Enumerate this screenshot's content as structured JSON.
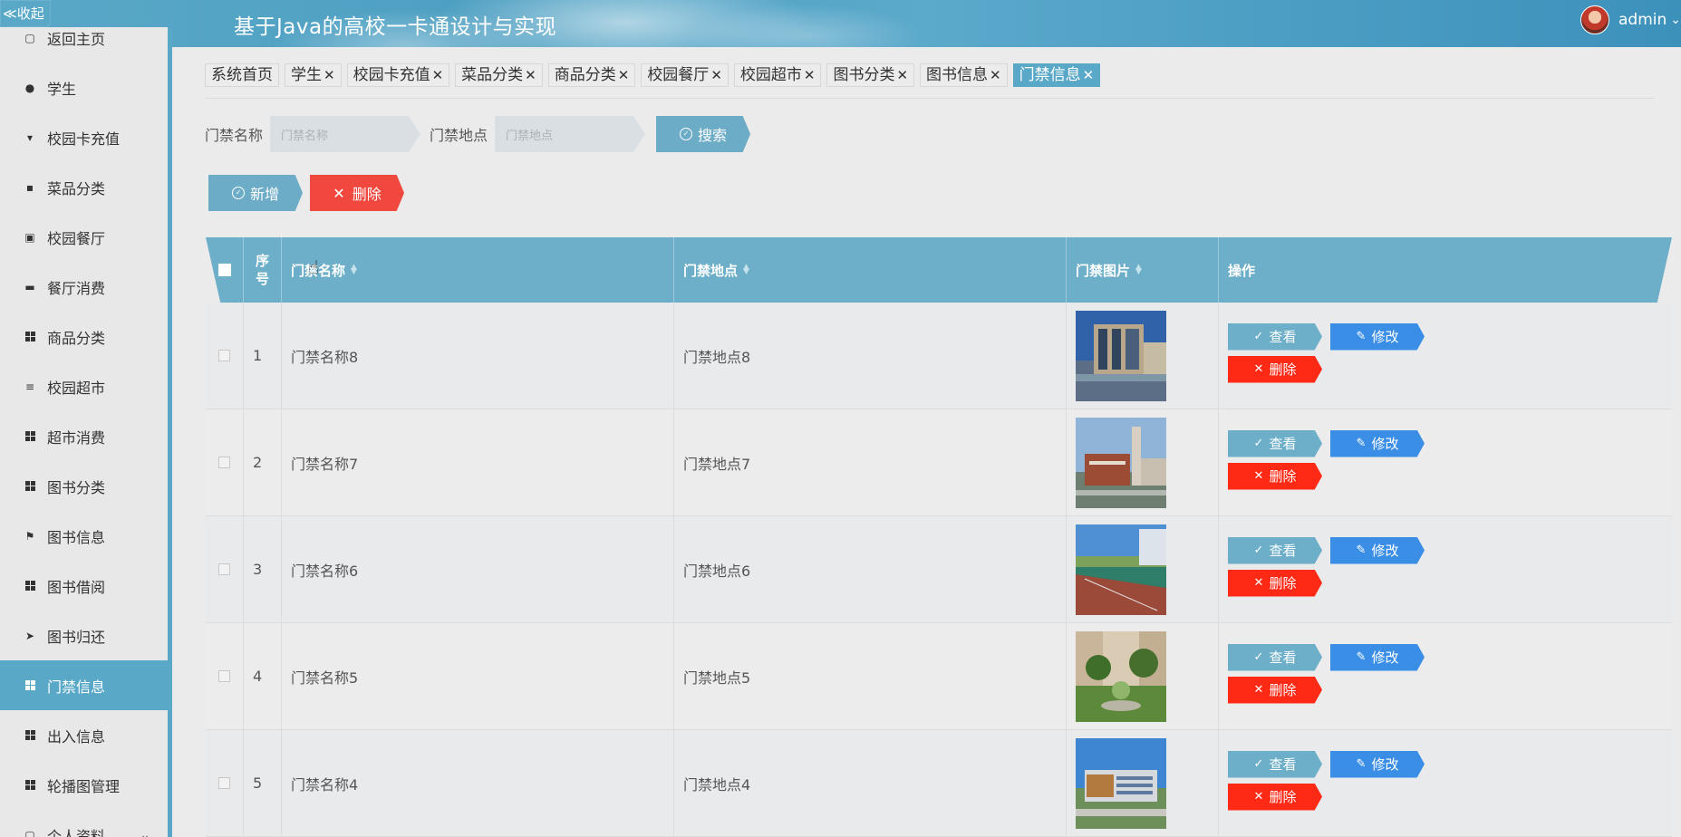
{
  "header": {
    "title": "基于Java的高校一卡通设计与实现",
    "username": "admin"
  },
  "collapse_label": "≪收起",
  "sidebar": {
    "items": [
      {
        "label": "返回主页",
        "icon": "home-icon"
      },
      {
        "label": "学生",
        "icon": "user-icon"
      },
      {
        "label": "校园卡充值",
        "icon": "card-icon"
      },
      {
        "label": "菜品分类",
        "icon": "chat-icon"
      },
      {
        "label": "校园餐厅",
        "icon": "clipboard-icon"
      },
      {
        "label": "餐厅消费",
        "icon": "monitor-icon"
      },
      {
        "label": "商品分类",
        "icon": "grid-icon"
      },
      {
        "label": "校园超市",
        "icon": "list-icon"
      },
      {
        "label": "超市消费",
        "icon": "grid-icon"
      },
      {
        "label": "图书分类",
        "icon": "grid-icon"
      },
      {
        "label": "图书信息",
        "icon": "flag-icon"
      },
      {
        "label": "图书借阅",
        "icon": "grid-icon"
      },
      {
        "label": "图书归还",
        "icon": "send-icon"
      },
      {
        "label": "门禁信息",
        "icon": "grid-icon"
      },
      {
        "label": "出入信息",
        "icon": "grid-icon"
      },
      {
        "label": "轮播图管理",
        "icon": "grid-icon"
      },
      {
        "label": "个人资料",
        "icon": "user-icon"
      }
    ]
  },
  "tabs": [
    {
      "label": "系统首页"
    },
    {
      "label": "学生"
    },
    {
      "label": "校园卡充值"
    },
    {
      "label": "菜品分类"
    },
    {
      "label": "商品分类"
    },
    {
      "label": "校园餐厅"
    },
    {
      "label": "校园超市"
    },
    {
      "label": "图书分类"
    },
    {
      "label": "图书信息"
    },
    {
      "label": "门禁信息"
    }
  ],
  "search": {
    "name_label": "门禁名称",
    "name_placeholder": "门禁名称",
    "location_label": "门禁地点",
    "location_placeholder": "门禁地点",
    "button": "搜索"
  },
  "actions": {
    "add": "新增",
    "delete": "删除"
  },
  "table": {
    "headers": {
      "index": "序号",
      "name": "门禁名称",
      "location": "门禁地点",
      "image": "门禁图片",
      "ops": "操作"
    },
    "rows": [
      {
        "index": "1",
        "name": "门禁名称8",
        "location": "门禁地点8"
      },
      {
        "index": "2",
        "name": "门禁名称7",
        "location": "门禁地点7"
      },
      {
        "index": "3",
        "name": "门禁名称6",
        "location": "门禁地点6"
      },
      {
        "index": "4",
        "name": "门禁名称5",
        "location": "门禁地点5"
      },
      {
        "index": "5",
        "name": "门禁名称4",
        "location": "门禁地点4"
      }
    ],
    "row_buttons": {
      "view": "查看",
      "edit": "修改",
      "delete": "删除"
    }
  },
  "colors": {
    "accent": "#5aa8c8",
    "edit": "#3a8ee6",
    "danger": "#ff2a16"
  }
}
